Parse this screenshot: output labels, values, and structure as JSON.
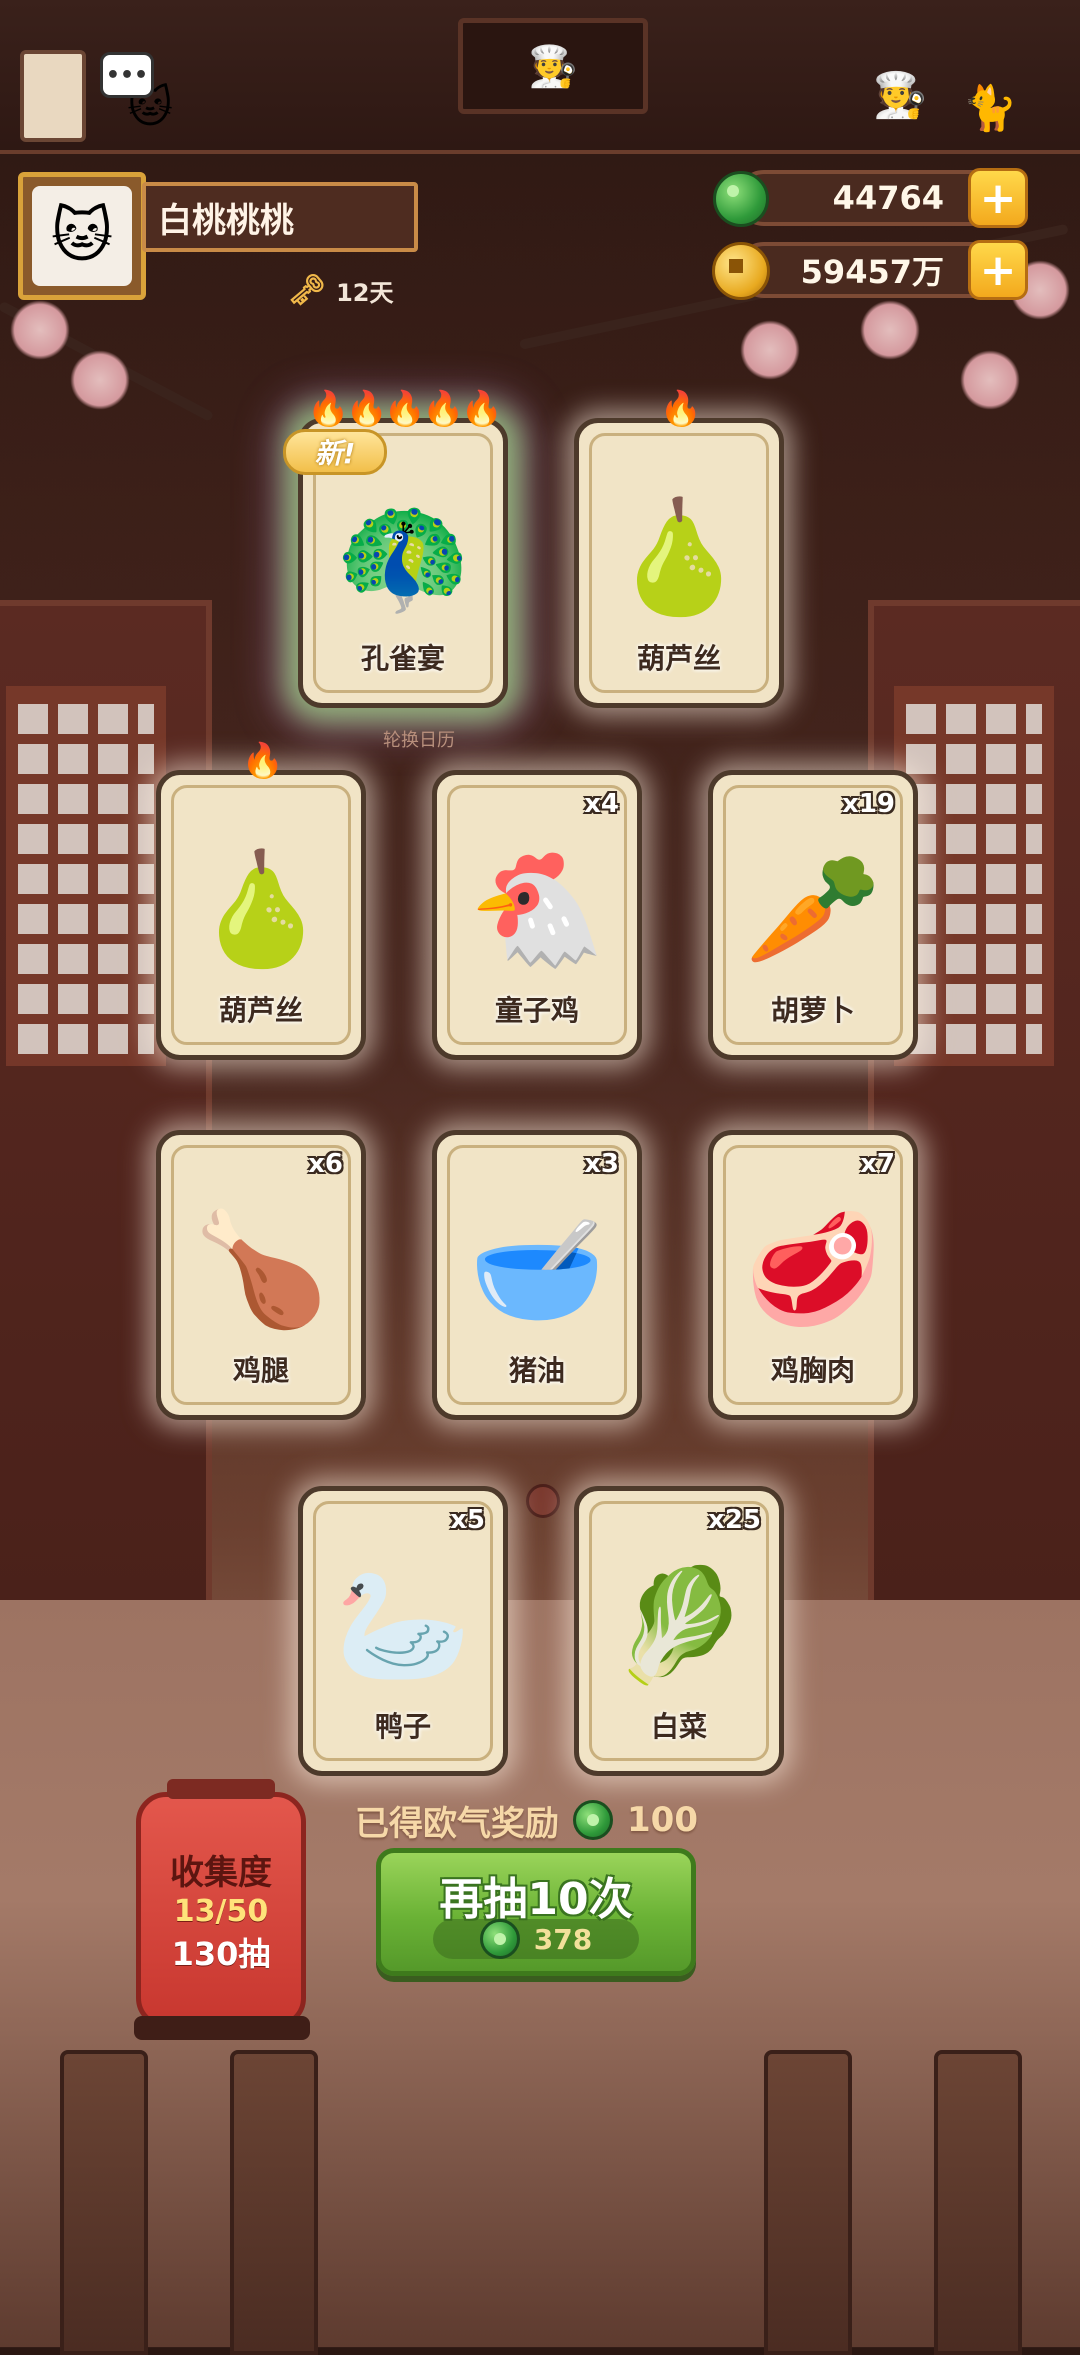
{
  "player": {
    "name": "白桃桃桃",
    "days": "12天"
  },
  "currency": {
    "jade": "44764",
    "coins": "59457万"
  },
  "calendar_label": "轮换日历",
  "cards": [
    {
      "name": "孔雀宴",
      "count": "",
      "flames": "🔥🔥🔥🔥🔥",
      "new": "新!",
      "food": "🦚"
    },
    {
      "name": "葫芦丝",
      "count": "",
      "flames": "🔥",
      "new": "",
      "food": "🍐"
    },
    {
      "name": "葫芦丝",
      "count": "",
      "flames": "🔥",
      "new": "",
      "food": "🍐"
    },
    {
      "name": "童子鸡",
      "count": "x4",
      "flames": "",
      "new": "",
      "food": "🐔"
    },
    {
      "name": "胡萝卜",
      "count": "x19",
      "flames": "",
      "new": "",
      "food": "🥕"
    },
    {
      "name": "鸡腿",
      "count": "x6",
      "flames": "",
      "new": "",
      "food": "🍗"
    },
    {
      "name": "猪油",
      "count": "x3",
      "flames": "",
      "new": "",
      "food": "🥣"
    },
    {
      "name": "鸡胸肉",
      "count": "x7",
      "flames": "",
      "new": "",
      "food": "🥩"
    },
    {
      "name": "鸭子",
      "count": "x5",
      "flames": "",
      "new": "",
      "food": "🦢"
    },
    {
      "name": "白菜",
      "count": "x25",
      "flames": "",
      "new": "",
      "food": "🥬"
    }
  ],
  "reward": {
    "label": "已得欧气奖励",
    "value": "100"
  },
  "draw_button": {
    "label": "再抽10次",
    "cost": "378"
  },
  "collection": {
    "title": "收集度",
    "progress": "13/50",
    "draws": "130抽"
  },
  "colors": {
    "accent_green": "#6ab235",
    "card_bg": "#f1e4c6",
    "gold": "#f3a91d",
    "lantern_red": "#c8372f"
  },
  "icons": [
    "scroll-icon",
    "chat-bubble-icon",
    "key-icon",
    "jade-icon",
    "coin-icon",
    "plus-icon",
    "flame-icon"
  ]
}
